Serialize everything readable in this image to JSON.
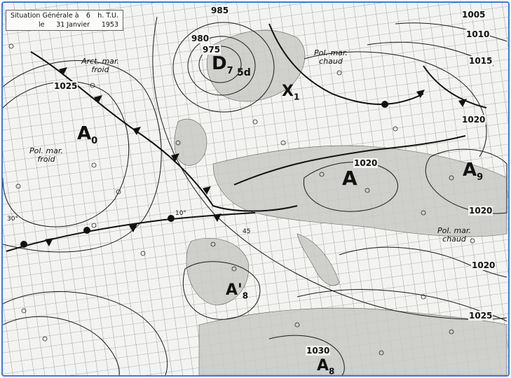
{
  "title": {
    "heading": "Situation Générale à",
    "hour": "6",
    "hour_unit": "h. T.U.",
    "date_prefix": "le",
    "date": "31 Janvier",
    "year": "1953"
  },
  "isobars": [
    "985",
    "980",
    "975",
    "1025",
    "1005",
    "1010",
    "1015",
    "1020",
    "1020",
    "1020",
    "1020",
    "1025",
    "1030"
  ],
  "air_masses": {
    "arctic_cold": "Arct. mar. froid",
    "polar_cold": "Pol. mar. froid",
    "polar_warm_north": "Pol. mar. chaud",
    "polar_warm_east": "Pol. mar. chaud"
  },
  "pressure_centers": {
    "low_d7": {
      "letter": "D",
      "sub": "7",
      "tag": "5d"
    },
    "x1": {
      "letter": "X",
      "sub": "1"
    },
    "high_a0": {
      "letter": "A",
      "sub": "0"
    },
    "high_a_central": {
      "letter": "A",
      "sub": ""
    },
    "high_a9": {
      "letter": "A",
      "sub": "9"
    },
    "high_a8": {
      "letter": "A'",
      "sub": "8"
    },
    "high_a8_south": {
      "letter": "A",
      "sub": "8"
    }
  },
  "latitude_labels": [
    "30°",
    "10°",
    "45"
  ],
  "colors": {
    "frame": "#3a7bd5",
    "ink": "#1a1a1a",
    "paper": "#f3f3f1",
    "land": "#c9c9c6"
  }
}
